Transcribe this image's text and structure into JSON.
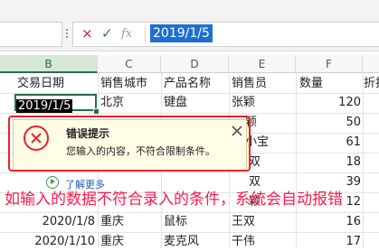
{
  "formula_bar": {
    "cancel_icon": "×",
    "confirm_icon": "✓",
    "fx_label": "fx",
    "value": "2019/1/5"
  },
  "columns": [
    "B",
    "C",
    "D",
    "E",
    "F"
  ],
  "headers": {
    "date": "交易日期",
    "city": "销售城市",
    "product": "产品名称",
    "seller": "销售员",
    "qty": "数量",
    "partial": "折扣"
  },
  "rows": [
    {
      "date": "2019/1/5",
      "city": "北京",
      "product": "键盘",
      "seller": "张颖",
      "qty": "120"
    },
    {
      "seller": "颖",
      "qty": "50"
    },
    {
      "seller": "小宝",
      "qty": "61"
    },
    {
      "seller": "双",
      "qty": "18"
    },
    {
      "seller": "双",
      "qty": "39"
    },
    {
      "seller": "颖",
      "qty": "12"
    },
    {
      "date": "2020/1/8",
      "city": "重庆",
      "product": "鼠标",
      "seller": "王双",
      "qty": "16"
    },
    {
      "date": "2020/1/10",
      "city": "重庆",
      "product": "麦克风",
      "seller": "干伟",
      "qty": "17"
    }
  ],
  "error_dialog": {
    "title": "错误提示",
    "message": "您输入的内容，不符合限制条件。",
    "learn_more": "了解更多"
  },
  "annotation": "如输入的数据不符合录入的条件，系统会自动报错",
  "colors": {
    "accent_green": "#217346",
    "error_red": "#e8232b",
    "annotation_pink": "#ff1a4b",
    "selection_blue": "#1f6fd2"
  }
}
